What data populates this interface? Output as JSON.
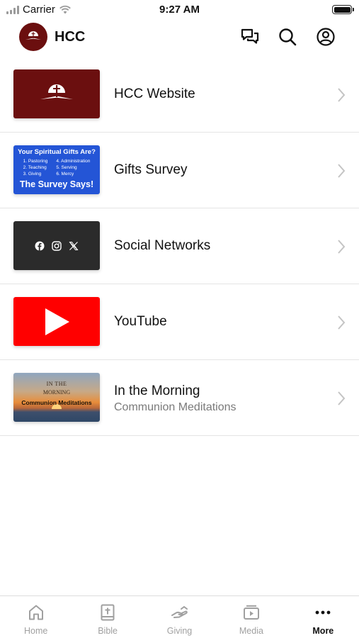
{
  "status_bar": {
    "carrier": "Carrier",
    "time": "9:27 AM"
  },
  "header": {
    "title": "HCC"
  },
  "list": [
    {
      "title": "HCC Website",
      "subtitle": ""
    },
    {
      "title": "Gifts Survey",
      "subtitle": ""
    },
    {
      "title": "Social Networks",
      "subtitle": ""
    },
    {
      "title": "YouTube",
      "subtitle": ""
    },
    {
      "title": "In the Morning",
      "subtitle": "Communion Meditations"
    }
  ],
  "survey_thumb": {
    "heading": "Your Spiritual Gifts Are?",
    "col1": [
      "1. Pastoring",
      "2. Teaching",
      "3. Giving"
    ],
    "col2": [
      "4. Administration",
      "5. Serving",
      "6. Mercy"
    ],
    "footer": "The Survey Says!"
  },
  "morning_thumb": {
    "line1": "IN THE",
    "line2": "MORNING",
    "line3": "Communion Meditations"
  },
  "tabs": [
    {
      "label": "Home",
      "icon": "home-icon"
    },
    {
      "label": "Bible",
      "icon": "bible-icon"
    },
    {
      "label": "Giving",
      "icon": "giving-icon"
    },
    {
      "label": "Media",
      "icon": "media-icon"
    },
    {
      "label": "More",
      "icon": "more-icon",
      "active": true
    }
  ],
  "colors": {
    "accent": "#6b0f0f",
    "survey": "#2455d6",
    "youtube": "#ff0000",
    "social": "#2b2b2b",
    "tab_inactive": "#a0a0a0"
  }
}
